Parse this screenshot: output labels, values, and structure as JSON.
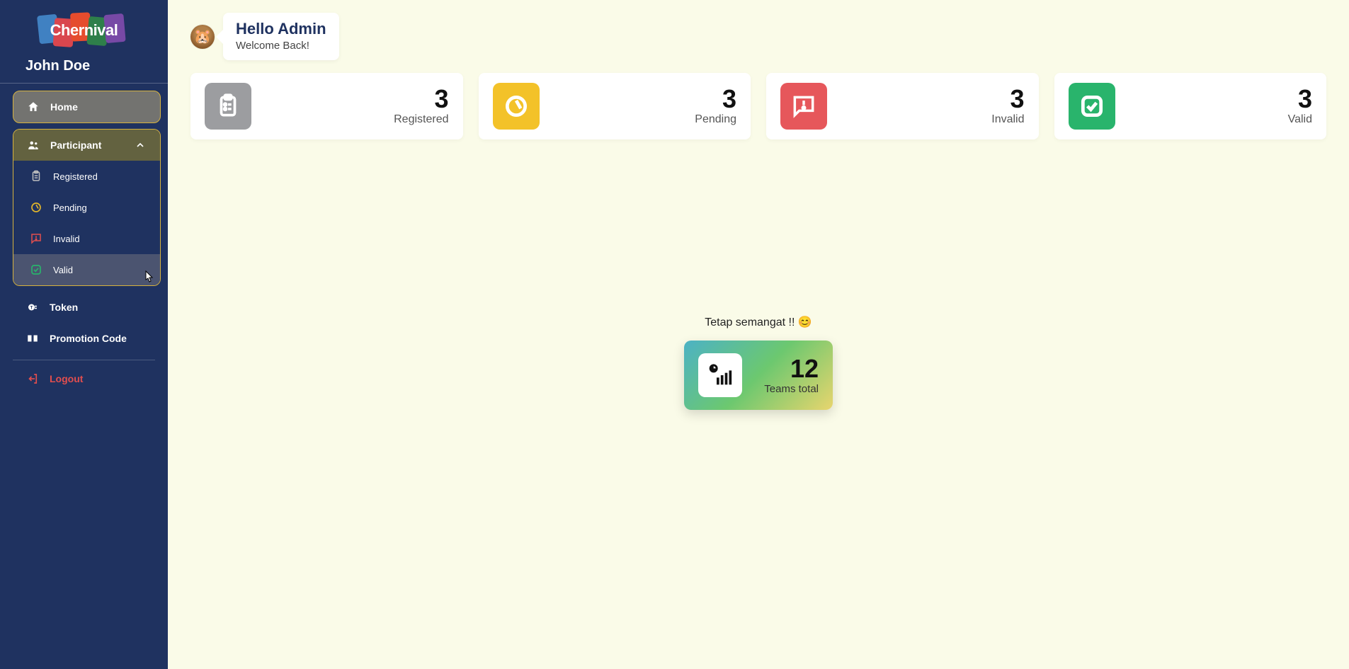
{
  "brand": "Chernival",
  "user": {
    "name": "John Doe"
  },
  "nav": {
    "home": "Home",
    "participant": "Participant",
    "sub": {
      "registered": "Registered",
      "pending": "Pending",
      "invalid": "Invalid",
      "valid": "Valid"
    },
    "token": "Token",
    "promo": "Promotion Code",
    "logout": "Logout"
  },
  "greeting": {
    "title": "Hello Admin",
    "subtitle": "Welcome Back!"
  },
  "stats": {
    "registered": {
      "value": "3",
      "label": "Registered"
    },
    "pending": {
      "value": "3",
      "label": "Pending"
    },
    "invalid": {
      "value": "3",
      "label": "Invalid"
    },
    "valid": {
      "value": "3",
      "label": "Valid"
    }
  },
  "center": {
    "message": "Tetap semangat !! 😊",
    "total": {
      "value": "12",
      "label": "Teams total"
    }
  },
  "colors": {
    "sidebar": "#1f3260",
    "accent_border": "#d7b33e",
    "gray": "#9c9da0",
    "yellow": "#f3c229",
    "red": "#e6575b",
    "green": "#29b46c"
  }
}
